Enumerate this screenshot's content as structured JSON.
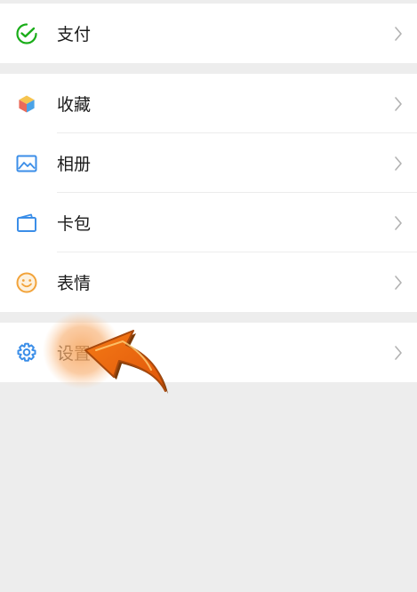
{
  "menu": {
    "pay": {
      "label": "支付",
      "icon": "pay-check-icon"
    },
    "favorites": {
      "label": "收藏",
      "icon": "cube-icon"
    },
    "album": {
      "label": "相册",
      "icon": "image-icon"
    },
    "cards": {
      "label": "卡包",
      "icon": "wallet-icon"
    },
    "stickers": {
      "label": "表情",
      "icon": "smiley-icon"
    },
    "settings": {
      "label": "设置",
      "icon": "gear-icon"
    }
  },
  "colors": {
    "pay_green": "#1aad19",
    "icon_blue": "#3b8ee8",
    "smiley_orange": "#f2a33a",
    "arrow_orange": "#f47a16",
    "chevron": "#b2b2b2",
    "background": "#ededed"
  },
  "annotation": {
    "pointer_icon": "cursor-arrow-icon",
    "highlight": "tap-highlight-circle"
  }
}
